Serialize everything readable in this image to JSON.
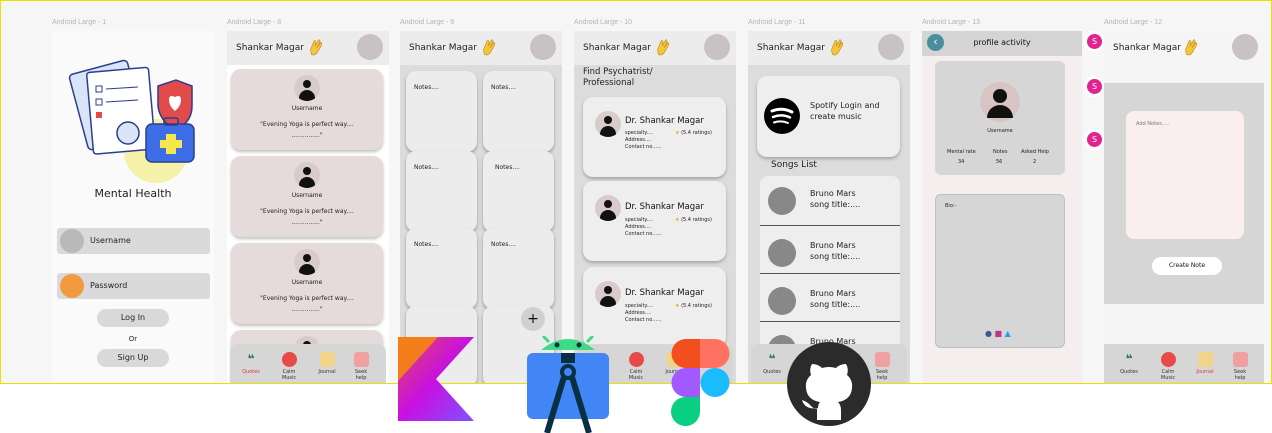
{
  "frames": {
    "f1": "Android Large - 1",
    "f8": "Android Large - 8",
    "f9": "Android Large - 9",
    "f10": "Android Large - 10",
    "f11": "Android Large - 11",
    "f13": "Android Large - 13",
    "f12": "Android Large - 12"
  },
  "login": {
    "title": "Mental Health",
    "username": "Username",
    "password": "Password",
    "login": "Log In",
    "or": "Or",
    "signup": "Sign Up"
  },
  "user_name": "Shankar Magar",
  "feed": {
    "username": "Username",
    "quote": "\"Evening Yoga is perfect way....",
    "quote2": "...............\""
  },
  "notes_label": "Notes....",
  "notes_plus": "+",
  "psych": {
    "heading": "Find Psychatrist/\nProfessional",
    "name": "Dr. Shankar Magar",
    "speciality": "specialty....",
    "rating": "(5.4 ratings)",
    "address": "Address....",
    "contact": "Contact no......"
  },
  "music": {
    "spotify": "Spotify Login and\ncreate music",
    "songs_list": "Songs List",
    "song_artist": "Bruno Mars",
    "song_title": "song title:....",
    "song_title_b": "Bruno Mars\nsong title:....."
  },
  "profile": {
    "title": "profile activity",
    "username": "Username",
    "stats": [
      {
        "label": "Mental rate",
        "value": "34"
      },
      {
        "label": "Notes",
        "value": "56"
      },
      {
        "label": "Asked Help",
        "value": "2"
      }
    ],
    "bio": "Bio:-"
  },
  "create": {
    "placeholder": "Add Notes.....",
    "button": "Create Note"
  },
  "badge": "S",
  "nav": {
    "quotes": "Quotes",
    "calm": "Calm\nMusic",
    "journal": "Journal",
    "seek": "Seek\nhelp",
    "seek_b": "Seek\nhelp"
  },
  "colors": {
    "accent": "#e0238f",
    "card": "#e6dbdb",
    "kotlin": "#7f52ff",
    "android": "#3ddc84",
    "back_btn": "#4a8f9c"
  }
}
